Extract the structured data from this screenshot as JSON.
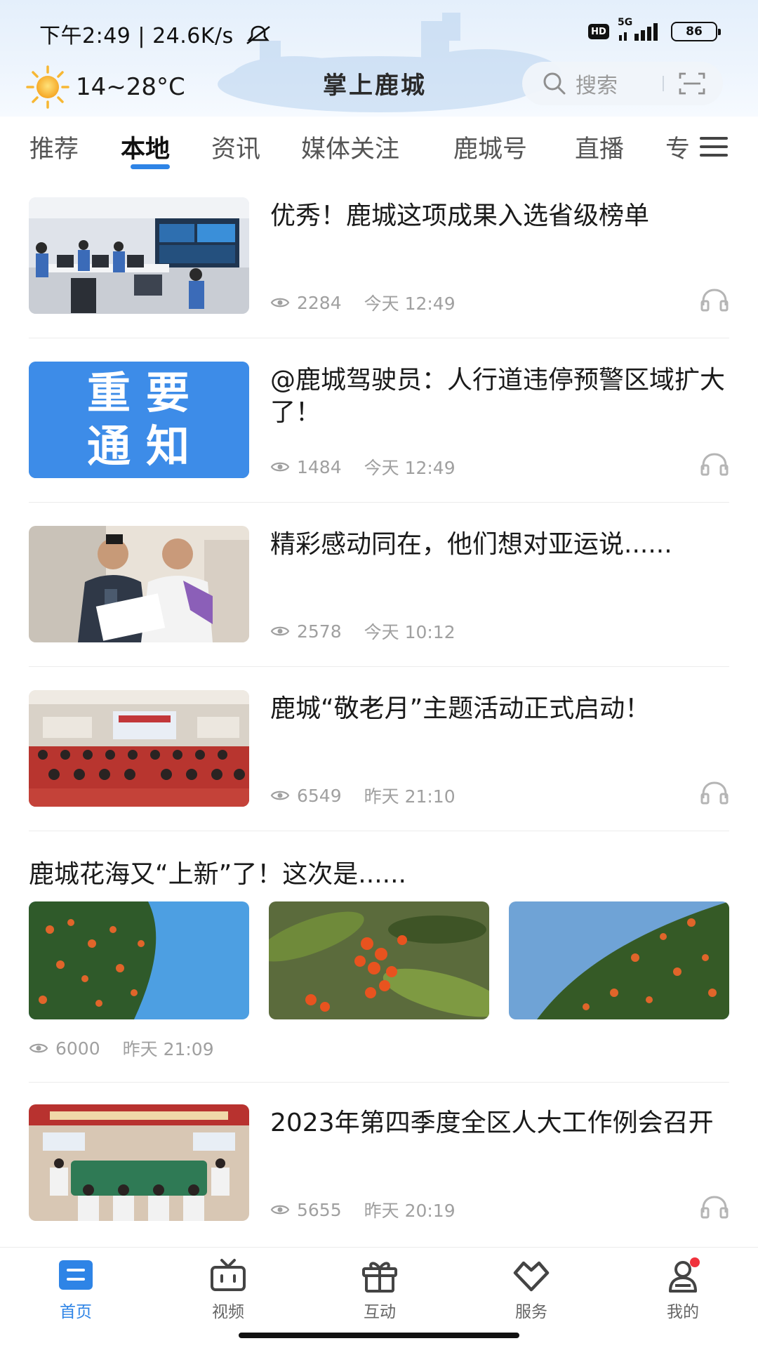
{
  "status_bar": {
    "time": "下午2:49",
    "speed": "24.6K/s",
    "hd": "HD",
    "network": "5G",
    "battery": "86"
  },
  "header": {
    "temperature": "14~28°C",
    "title": "掌上鹿城",
    "search_placeholder": "搜索"
  },
  "tabs": [
    {
      "label": "推荐"
    },
    {
      "label": "本地"
    },
    {
      "label": "资讯"
    },
    {
      "label": "媒体关注"
    },
    {
      "label": "鹿城号"
    },
    {
      "label": "直播"
    },
    {
      "label": "专"
    }
  ],
  "notice_image_text": [
    "重要",
    "通知"
  ],
  "news": [
    {
      "title": "优秀！鹿城这项成果入选省级榜单",
      "views": "2284",
      "time": "今天 12:49"
    },
    {
      "title": "@鹿城驾驶员：人行道违停预警区域扩大了！",
      "views": "1484",
      "time": "今天 12:49"
    },
    {
      "title": "精彩感动同在，他们想对亚运说......",
      "views": "2578",
      "time": "今天 10:12"
    },
    {
      "title": "鹿城“敬老月”主题活动正式启动！",
      "views": "6549",
      "time": "昨天 21:10"
    },
    {
      "title": "2023年第四季度全区人大工作例会召开",
      "views": "5655",
      "time": "昨天 20:19"
    }
  ],
  "gallery": {
    "title": "鹿城花海又“上新”了！这次是......",
    "views": "6000",
    "time": "昨天 21:09"
  },
  "bottom_nav": [
    {
      "label": "首页"
    },
    {
      "label": "视频"
    },
    {
      "label": "互动"
    },
    {
      "label": "服务"
    },
    {
      "label": "我的"
    }
  ],
  "colors": {
    "accent": "#2e84e6",
    "notification_dot": "#f0323c"
  }
}
